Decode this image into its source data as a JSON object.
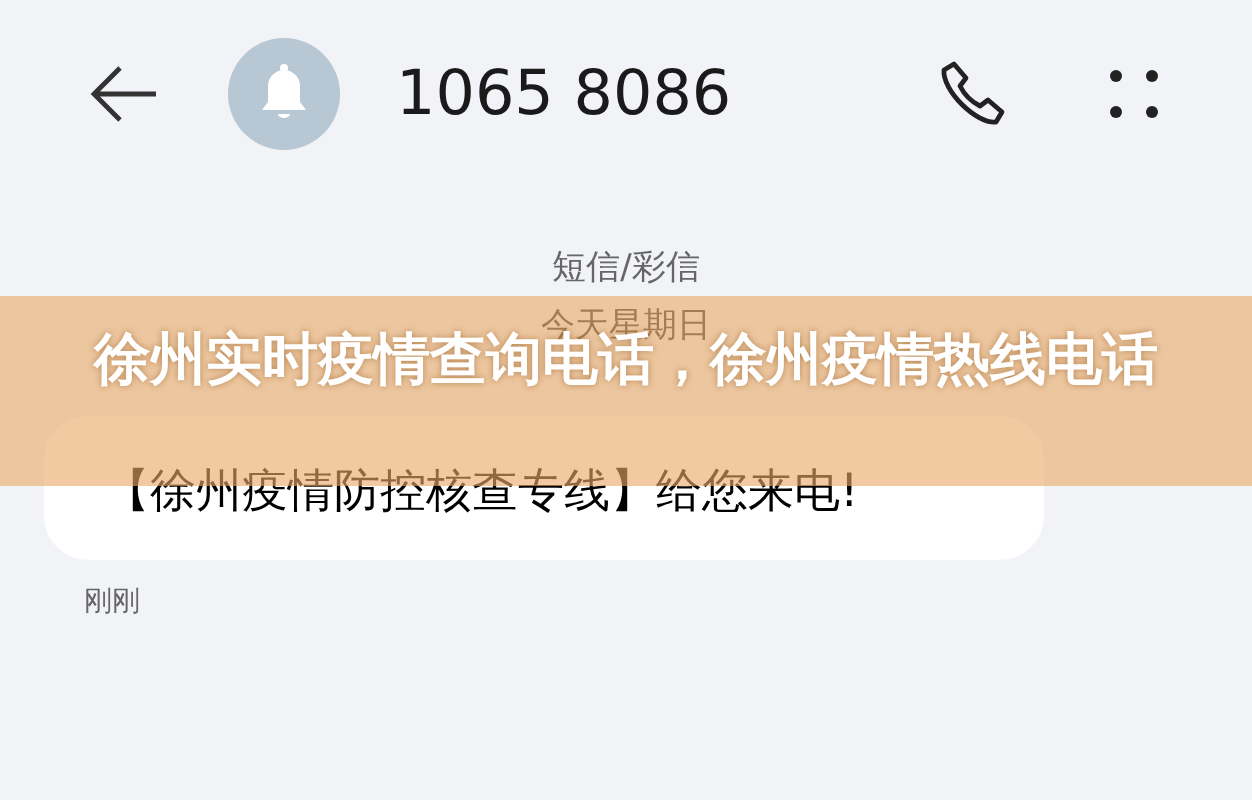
{
  "header": {
    "contact": "1065 8086"
  },
  "thread": {
    "category": "短信/彩信",
    "date": "今天星期日",
    "messages": [
      {
        "text": "【徐州疫情防控核查专线】给您来电!",
        "time": "刚刚"
      }
    ]
  },
  "banner": {
    "title": "徐州实时疫情查询电话，徐州疫情热线电话"
  }
}
